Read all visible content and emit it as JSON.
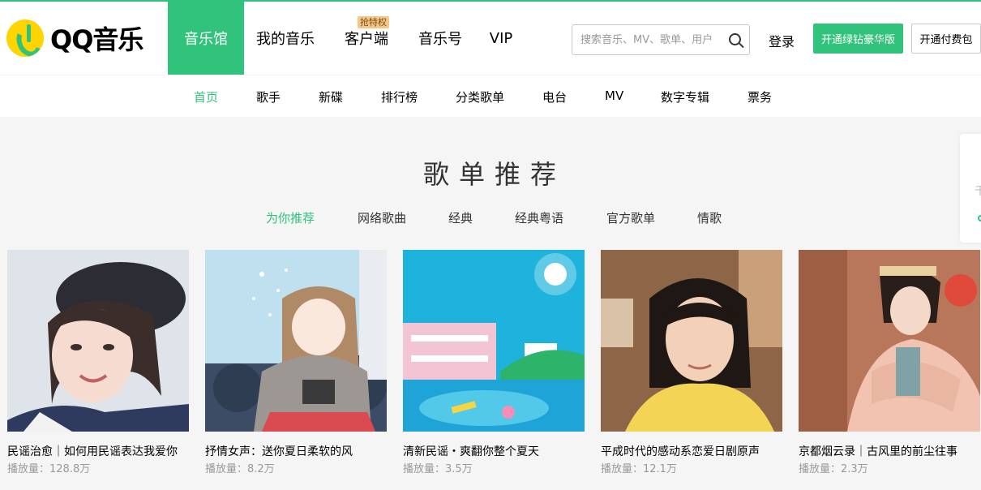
{
  "logo": {
    "text": "QQ音乐",
    "brand_color": "#31c27c",
    "mark_color": "#ffd400"
  },
  "main_nav": [
    {
      "label": "音乐馆",
      "active": true
    },
    {
      "label": "我的音乐"
    },
    {
      "label": "客户端",
      "badge": "抢特权"
    },
    {
      "label": "音乐号"
    },
    {
      "label": "VIP"
    }
  ],
  "search": {
    "placeholder": "搜索音乐、MV、歌单、用户",
    "icon": "search-icon"
  },
  "header_actions": {
    "login": "登录",
    "vip_button": "开通绿钻豪华版",
    "pay_button": "开通付费包"
  },
  "sub_nav": [
    {
      "label": "首页",
      "active": true
    },
    {
      "label": "歌手"
    },
    {
      "label": "新碟"
    },
    {
      "label": "排行榜"
    },
    {
      "label": "分类歌单"
    },
    {
      "label": "电台"
    },
    {
      "label": "MV"
    },
    {
      "label": "数字专辑"
    },
    {
      "label": "票务"
    }
  ],
  "section": {
    "title": "歌单推荐",
    "tabs": [
      {
        "label": "为你推荐",
        "active": true
      },
      {
        "label": "网络歌曲"
      },
      {
        "label": "经典"
      },
      {
        "label": "经典粤语"
      },
      {
        "label": "官方歌单"
      },
      {
        "label": "情歌"
      }
    ]
  },
  "side_tab": {
    "glyph": "千"
  },
  "playlists": [
    {
      "name": "民谣治愈｜如何用民谣表达我爱你",
      "plays": "播放量：128.8万"
    },
    {
      "name": "抒情女声：送你夏日柔软的风",
      "plays": "播放量：8.2万"
    },
    {
      "name": "清新民谣・爽翻你整个夏天",
      "plays": "播放量：3.5万"
    },
    {
      "name": "平成时代的感动系恋爱日剧原声",
      "plays": "播放量：12.1万"
    },
    {
      "name": "京都烟云录｜古风里的前尘往事",
      "plays": "播放量：2.3万"
    }
  ],
  "colors": {
    "accent": "#31c27c",
    "page_bg": "#f5f5f5",
    "muted": "#999999"
  }
}
